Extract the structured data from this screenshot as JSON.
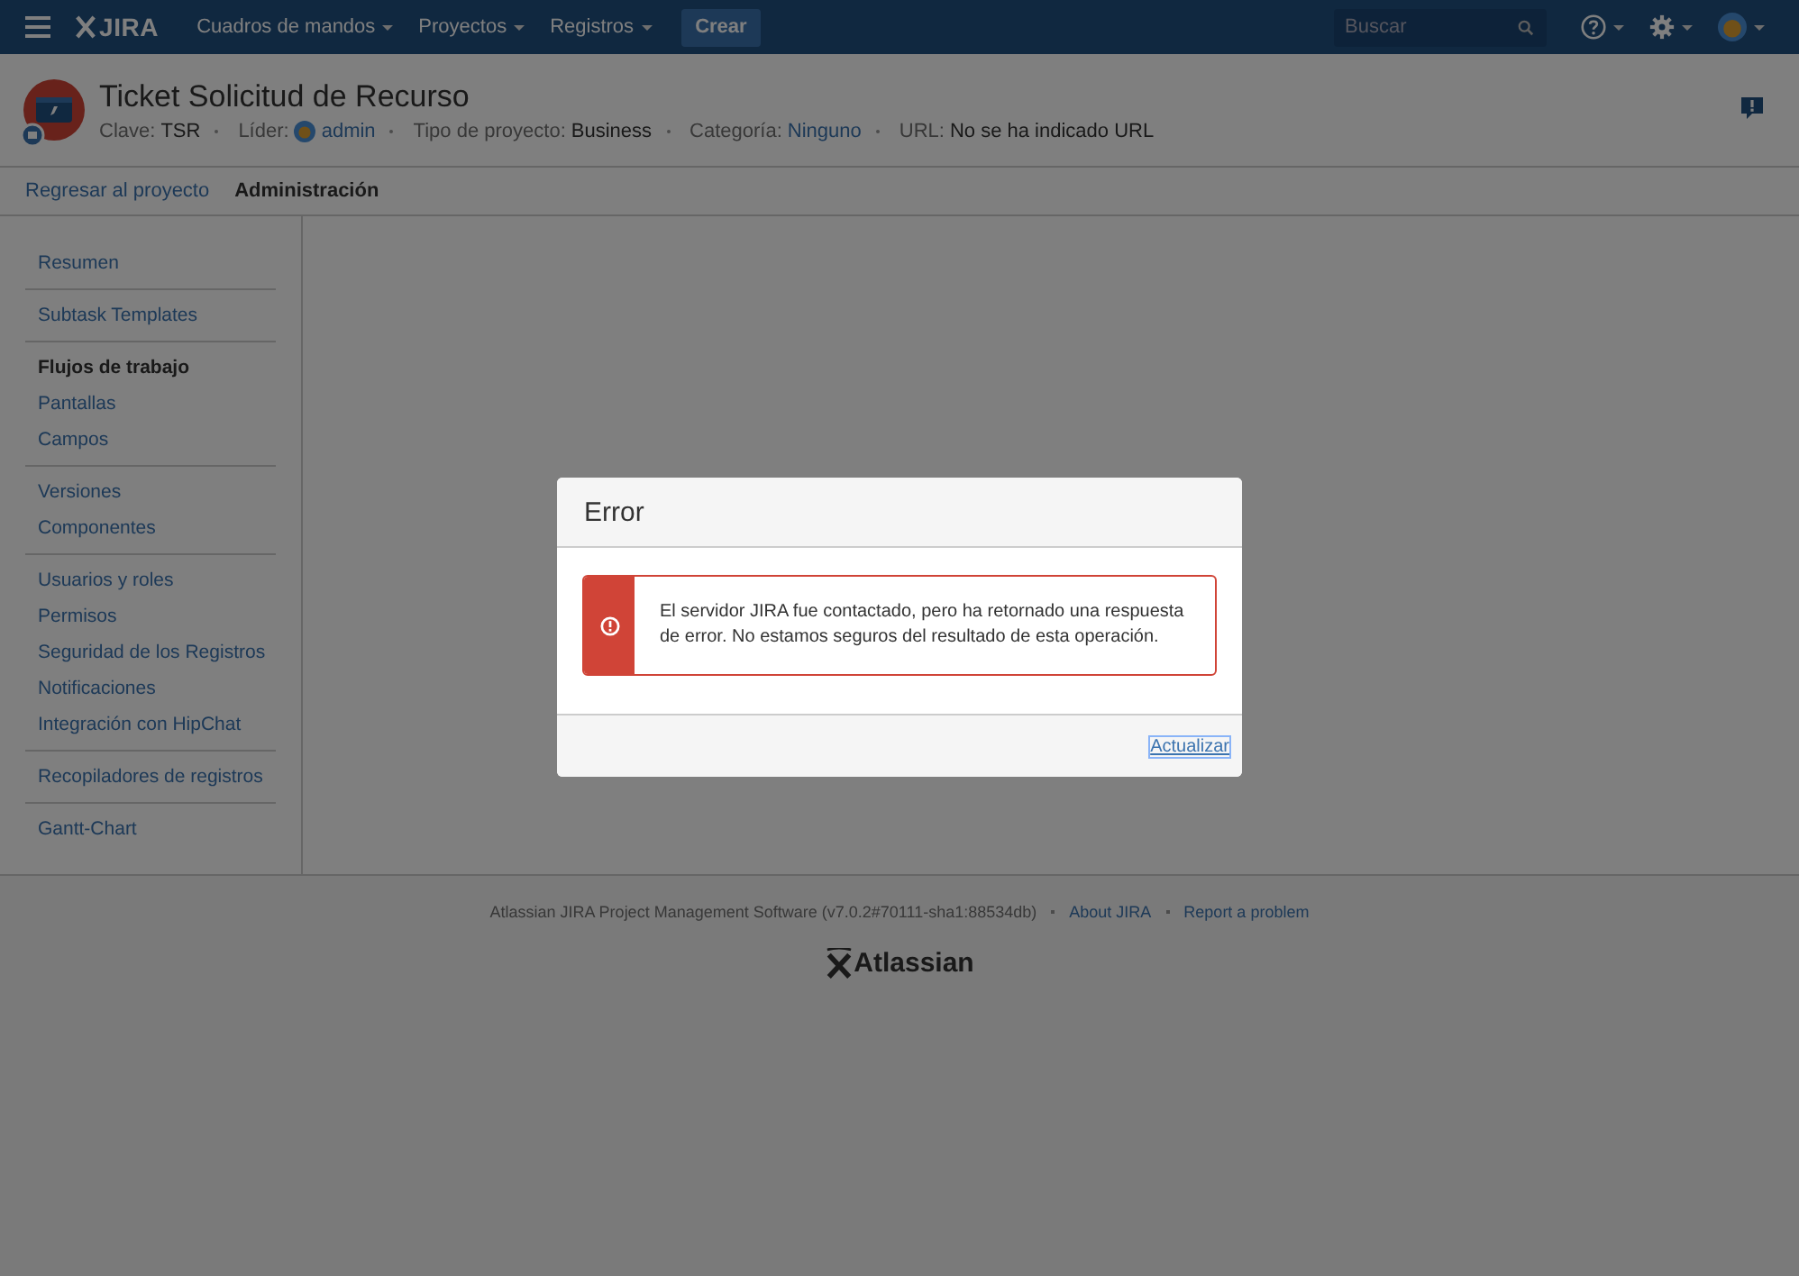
{
  "topbar": {
    "logo": "JIRA",
    "menus": [
      {
        "label": "Cuadros de mandos"
      },
      {
        "label": "Proyectos"
      },
      {
        "label": "Registros"
      }
    ],
    "create_button": "Crear",
    "search": {
      "placeholder": "Buscar"
    }
  },
  "project": {
    "title": "Ticket Solicitud de Recurso",
    "meta": [
      {
        "label": "Clave:",
        "value": "TSR",
        "kind": "text"
      },
      {
        "label": "Líder:",
        "value": "admin",
        "kind": "user"
      },
      {
        "label": "Tipo de proyecto:",
        "value": "Business",
        "kind": "text"
      },
      {
        "label": "Categoría:",
        "value": "Ninguno",
        "kind": "link"
      },
      {
        "label": "URL:",
        "value": "No se ha indicado URL",
        "kind": "text"
      }
    ]
  },
  "nav": [
    {
      "label": "Regresar al proyecto",
      "selected": false
    },
    {
      "label": "Administración",
      "selected": true
    }
  ],
  "sidebar": {
    "groups": [
      [
        {
          "label": "Resumen",
          "selected": false
        }
      ],
      [
        {
          "label": "Subtask Templates",
          "selected": false
        }
      ],
      [
        {
          "label": "Flujos de trabajo",
          "selected": true
        },
        {
          "label": "Pantallas",
          "selected": false
        },
        {
          "label": "Campos",
          "selected": false
        }
      ],
      [
        {
          "label": "Versiones",
          "selected": false
        },
        {
          "label": "Componentes",
          "selected": false
        }
      ],
      [
        {
          "label": "Usuarios y roles",
          "selected": false
        },
        {
          "label": "Permisos",
          "selected": false
        },
        {
          "label": "Seguridad de los Registros",
          "selected": false
        },
        {
          "label": "Notificaciones",
          "selected": false
        },
        {
          "label": "Integración con HipChat",
          "selected": false
        }
      ],
      [
        {
          "label": "Recopiladores de registros",
          "selected": false
        }
      ],
      [
        {
          "label": "Gantt-Chart",
          "selected": false
        }
      ]
    ]
  },
  "footer": {
    "text": "Atlassian JIRA Project Management Software (v7.0.2#70111-sha1:88534db)",
    "links": [
      "About JIRA",
      "Report a problem"
    ],
    "logo": "Atlassian"
  },
  "dialog": {
    "title": "Error",
    "message": "El servidor JIRA fue contactado, pero ha retornado una respuesta de error. No estamos seguros del resultado de esta operación.",
    "action": "Actualizar"
  }
}
